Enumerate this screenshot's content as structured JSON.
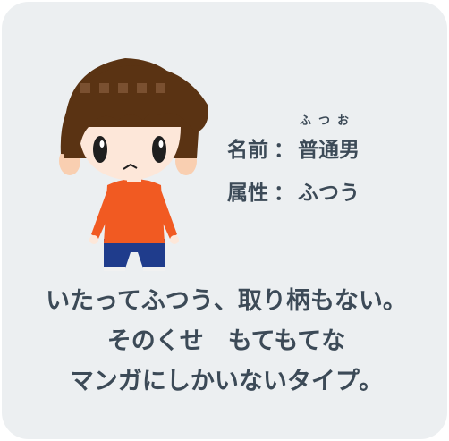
{
  "profile": {
    "name_label": "名前",
    "name_ruby": "ふつお",
    "name_value": "普通男",
    "attribute_label": "属性",
    "attribute_value": "ふつう",
    "colon": "："
  },
  "description": {
    "lines": [
      "いたってふつう、取り柄もない。",
      "そのくせ　もてもてな",
      "マンガにしかいないタイプ。"
    ]
  },
  "colors": {
    "card_background": "#eceff1",
    "text": "#3c4a57",
    "hair": "#5a3313",
    "shirt": "#f15a22",
    "pants": "#1f3c8c",
    "skin": "#fde7d9"
  },
  "icons": {
    "character": "boy-character-illustration"
  }
}
